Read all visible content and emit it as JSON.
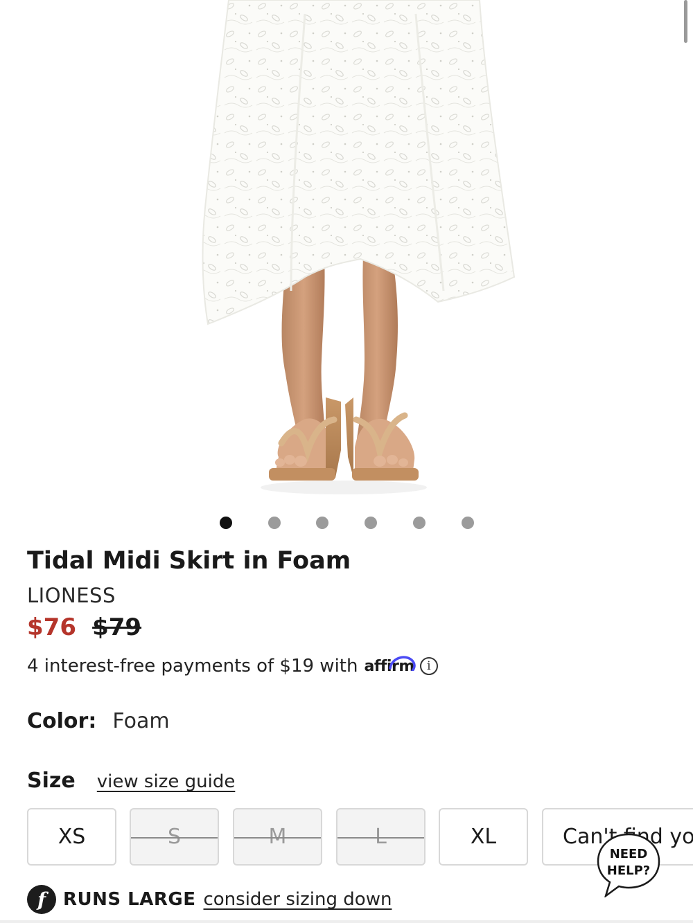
{
  "product": {
    "title": "Tidal Midi Skirt in Foam",
    "brand": "LIONESS",
    "price_sale": "$76",
    "price_original": "$79",
    "installments_text": "4 interest-free payments of $19 with",
    "affirm_logo": "affirm",
    "info_icon": "i",
    "image_alt": "Model wearing white eyelet midi skirt with tan wedge flip-flop sandals"
  },
  "carousel": {
    "total": 6,
    "active_index": 0
  },
  "color": {
    "label": "Color",
    "separator": ":",
    "value": "Foam"
  },
  "size": {
    "label": "Size",
    "guide_link": "view size guide",
    "options": [
      {
        "label": "XS",
        "available": true
      },
      {
        "label": "S",
        "available": false
      },
      {
        "label": "M",
        "available": false
      },
      {
        "label": "L",
        "available": false
      },
      {
        "label": "XL",
        "available": true
      },
      {
        "label": "Can't find your size?",
        "available": true
      }
    ]
  },
  "help": {
    "line1": "NEED",
    "line2": "HELP?"
  },
  "fit": {
    "icon_glyph": "f",
    "label": "RUNS LARGE",
    "link": "consider sizing down"
  },
  "colors": {
    "sale_price": "#b5352b",
    "active_dot": "#111111",
    "inactive_dot": "#9b9b9b",
    "affirm_blue": "#4a4af4"
  },
  "icons": {
    "info": "info-icon",
    "fit": "fit-predictor-icon",
    "help": "speech-bubble-icon"
  }
}
